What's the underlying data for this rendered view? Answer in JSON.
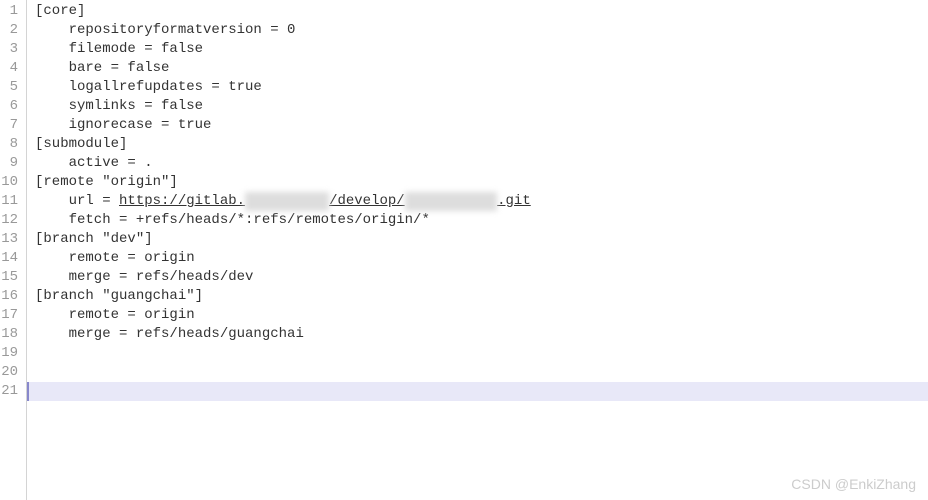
{
  "lines": [
    {
      "num": "1",
      "indent": "",
      "text": "[core]"
    },
    {
      "num": "2",
      "indent": "    ",
      "text": "repositoryformatversion = 0"
    },
    {
      "num": "3",
      "indent": "    ",
      "text": "filemode = false"
    },
    {
      "num": "4",
      "indent": "    ",
      "text": "bare = false"
    },
    {
      "num": "5",
      "indent": "    ",
      "text": "logallrefupdates = true"
    },
    {
      "num": "6",
      "indent": "    ",
      "text": "symlinks = false"
    },
    {
      "num": "7",
      "indent": "    ",
      "text": "ignorecase = true"
    },
    {
      "num": "8",
      "indent": "",
      "text": "[submodule]"
    },
    {
      "num": "9",
      "indent": "    ",
      "text": "active = ."
    },
    {
      "num": "10",
      "indent": "",
      "text": "[remote \"origin\"]"
    },
    {
      "num": "11",
      "indent": "    ",
      "text": "url = ",
      "link_pre": "https://gitlab.",
      "blur1": "xxxxxxxxxx",
      "link_mid": "/develop/",
      "blur2": "xxxxxxxxxxx",
      "link_post": ".git"
    },
    {
      "num": "12",
      "indent": "    ",
      "text": "fetch = +refs/heads/*:refs/remotes/origin/*"
    },
    {
      "num": "13",
      "indent": "",
      "text": "[branch \"dev\"]"
    },
    {
      "num": "14",
      "indent": "    ",
      "text": "remote = origin"
    },
    {
      "num": "15",
      "indent": "    ",
      "text": "merge = refs/heads/dev"
    },
    {
      "num": "16",
      "indent": "",
      "text": "[branch \"guangchai\"]"
    },
    {
      "num": "17",
      "indent": "    ",
      "text": "remote = origin"
    },
    {
      "num": "18",
      "indent": "    ",
      "text": "merge = refs/heads/guangchai"
    },
    {
      "num": "19",
      "indent": "",
      "text": ""
    },
    {
      "num": "20",
      "indent": "",
      "text": ""
    },
    {
      "num": "21",
      "indent": "",
      "text": "",
      "highlighted": true
    }
  ],
  "watermark": "CSDN @EnkiZhang"
}
